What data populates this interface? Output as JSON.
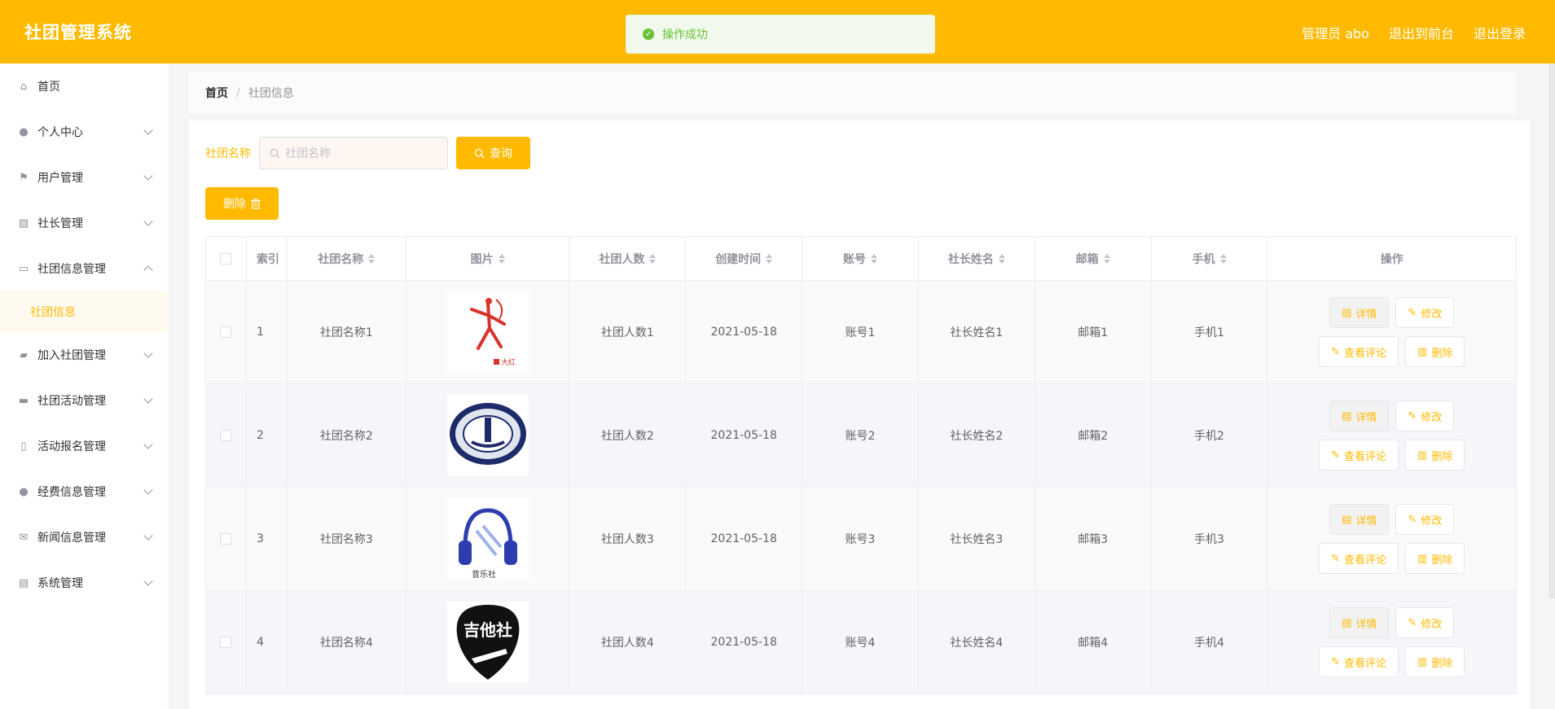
{
  "header": {
    "brand": "社团管理系统",
    "admin": "管理员 abo",
    "front": "退出到前台",
    "logout": "退出登录"
  },
  "toast": {
    "text": "操作成功",
    "color": "#67c23a"
  },
  "theme": {
    "accent": "#ffba00"
  },
  "sidebar": {
    "items": [
      {
        "label": "首页",
        "icon": "home-icon",
        "glyph": "⌂",
        "expandable": false
      },
      {
        "label": "个人中心",
        "icon": "user-icon",
        "glyph": "●",
        "expandable": true
      },
      {
        "label": "用户管理",
        "icon": "flag-icon",
        "glyph": "⚑",
        "expandable": true
      },
      {
        "label": "社长管理",
        "icon": "chart-icon",
        "glyph": "▨",
        "expandable": true
      },
      {
        "label": "社团信息管理",
        "icon": "chat-icon",
        "glyph": "▭",
        "expandable": true,
        "open": true
      },
      {
        "label": "加入社团管理",
        "icon": "wallet-icon",
        "glyph": "▰",
        "expandable": true
      },
      {
        "label": "社团活动管理",
        "icon": "monitor-icon",
        "glyph": "▬",
        "expandable": true
      },
      {
        "label": "活动报名管理",
        "icon": "phone-icon",
        "glyph": "▯",
        "expandable": true
      },
      {
        "label": "经费信息管理",
        "icon": "person-icon",
        "glyph": "●",
        "expandable": true
      },
      {
        "label": "新闻信息管理",
        "icon": "mail-icon",
        "glyph": "✉",
        "expandable": true
      },
      {
        "label": "系统管理",
        "icon": "clipboard-icon",
        "glyph": "▤",
        "expandable": true
      }
    ],
    "active_sub": "社团信息"
  },
  "breadcrumb": {
    "home": "首页",
    "separator": "/",
    "current": "社团信息"
  },
  "search": {
    "label": "社团名称",
    "placeholder": "社团名称",
    "button": "查询"
  },
  "actions": {
    "delete": "删除"
  },
  "table": {
    "headers": {
      "index": "索引",
      "name": "社团名称",
      "image": "图片",
      "count": "社团人数",
      "created": "创建时间",
      "account": "账号",
      "leader": "社长姓名",
      "email": "邮箱",
      "phone": "手机",
      "ops": "操作"
    },
    "ops": {
      "detail": "详情",
      "edit": "修改",
      "comments": "查看评论",
      "delete": "删除"
    },
    "rows": [
      {
        "index": "1",
        "name": "社团名称1",
        "count": "社团人数1",
        "created": "2021-05-18",
        "account": "账号1",
        "leader": "社长姓名1",
        "email": "邮箱1",
        "phone": "手机1",
        "image": "dance-logo",
        "image_text": "大红"
      },
      {
        "index": "2",
        "name": "社团名称2",
        "count": "社团人数2",
        "created": "2021-05-18",
        "account": "账号2",
        "leader": "社长姓名2",
        "email": "邮箱2",
        "phone": "手机2",
        "image": "emblem-logo",
        "image_text": ""
      },
      {
        "index": "3",
        "name": "社团名称3",
        "count": "社团人数3",
        "created": "2021-05-18",
        "account": "账号3",
        "leader": "社长姓名3",
        "email": "邮箱3",
        "phone": "手机3",
        "image": "headphones-logo",
        "image_text": "音乐社"
      },
      {
        "index": "4",
        "name": "社团名称4",
        "count": "社团人数4",
        "created": "2021-05-18",
        "account": "账号4",
        "leader": "社长姓名4",
        "email": "邮箱4",
        "phone": "手机4",
        "image": "guitar-pick-logo",
        "image_text": "吉他社"
      }
    ]
  }
}
